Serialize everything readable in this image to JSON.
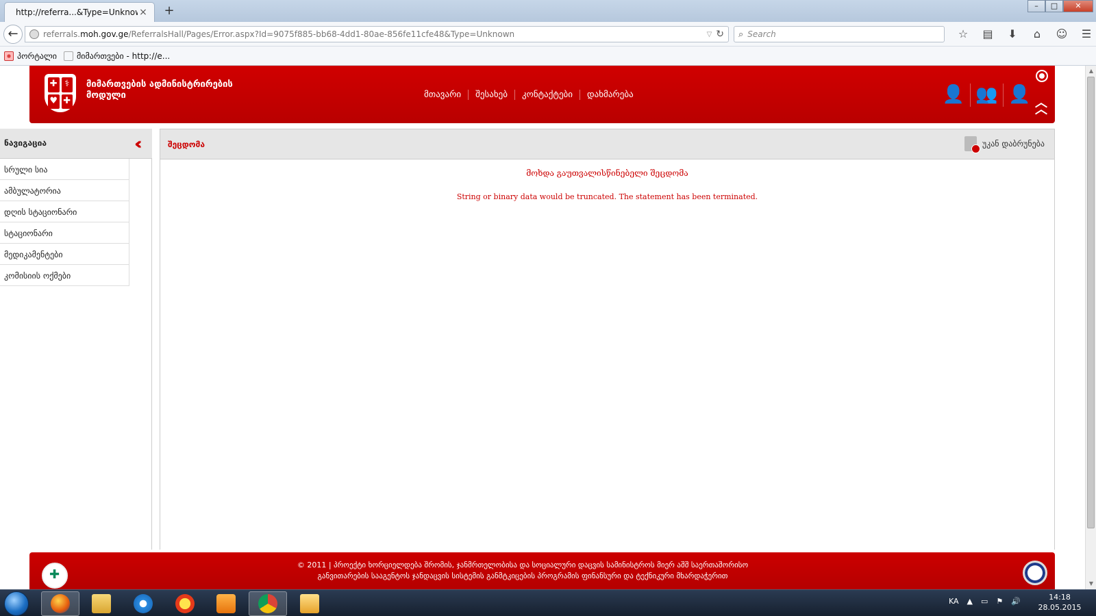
{
  "browser": {
    "tab_title": "http://referra...&Type=Unknown",
    "tab_close": "×",
    "new_tab": "+",
    "url_prefix": "referrals.",
    "url_host": "moh.gov.ge",
    "url_path": "/ReferralsHall/Pages/Error.aspx?Id=9075f885-bb68-4dd1-80ae-856fe11cfe48&Type=Unknown",
    "search_placeholder": "Search",
    "bookmarks": [
      {
        "label": "პორტალი"
      },
      {
        "label": "მიმართვები - http://e..."
      }
    ],
    "window_controls": {
      "minimize": "–",
      "maximize": "□",
      "close": "✕"
    }
  },
  "header": {
    "brand_line1": "მიმართვების ადმინისტრირების",
    "brand_line2": "მოდული",
    "nav": [
      {
        "label": "მთავარი"
      },
      {
        "label": "შესახებ"
      },
      {
        "label": "კონტაქტები"
      },
      {
        "label": "დახმარება"
      }
    ]
  },
  "sidebar": {
    "title": "ნავიგაცია",
    "items": [
      {
        "label": "სრული სია"
      },
      {
        "label": "ამბულატორია"
      },
      {
        "label": "დღის სტაციონარი"
      },
      {
        "label": "სტაციონარი"
      },
      {
        "label": "მედიკამენტები"
      },
      {
        "label": "კომისიის ოქმები"
      }
    ]
  },
  "content": {
    "title": "შეცდომა",
    "back_label": "უკან დაბრუნება",
    "error_title": "მოხდა გაუთვალისწინებელი შეცდომა",
    "error_message": "String or binary data would be truncated. The statement has been terminated."
  },
  "footer": {
    "line1": "© 2011 | პროექტი ხორციელდება შრომის, ჯანმრთელობისა და სოციალური დაცვის სამინისტროს მიერ აშშ საერთაშორისო",
    "line2": "განვითარების სააგენტოს ჯანდაცვის სისტემის განმტკიცების პროგრამის ფინანსური და ტექნიკური მხარდაჭერით"
  },
  "taskbar": {
    "language": "KA",
    "time": "14:18",
    "date": "28.05.2015"
  },
  "colors": {
    "brand_red": "#c00000",
    "error_red": "#cc0000"
  }
}
